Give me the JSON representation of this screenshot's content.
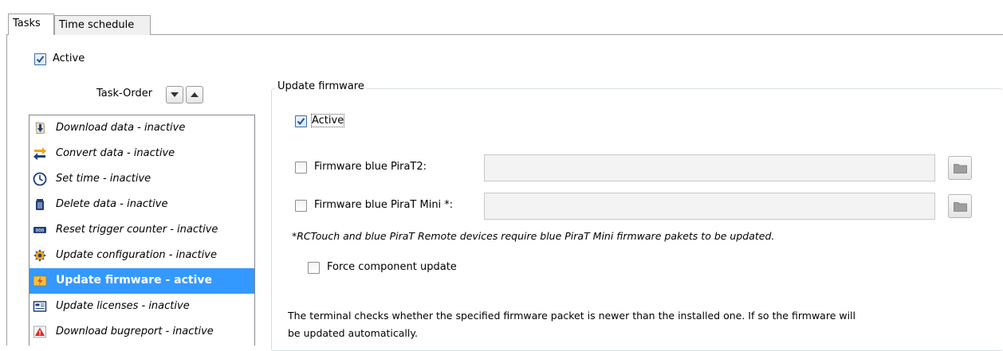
{
  "tabs": [
    {
      "label": "Tasks",
      "selected": true
    },
    {
      "label": "Time schedule",
      "selected": false
    }
  ],
  "active_checkbox": {
    "label": "Active",
    "checked": true
  },
  "task_order": {
    "label": "Task-Order"
  },
  "tasks": [
    {
      "label": "Download data - inactive",
      "icon": "download-arrow-icon",
      "selected": false
    },
    {
      "label": "Convert data - inactive",
      "icon": "convert-arrows-icon",
      "selected": false
    },
    {
      "label": "Set time - inactive",
      "icon": "clock-icon",
      "selected": false
    },
    {
      "label": "Delete data - inactive",
      "icon": "trash-icon",
      "selected": false
    },
    {
      "label": "Reset trigger counter - inactive",
      "icon": "counter-icon",
      "selected": false
    },
    {
      "label": "Update configuration - inactive",
      "icon": "gear-icon",
      "selected": false
    },
    {
      "label": "Update firmware - active",
      "icon": "firmware-icon",
      "selected": true
    },
    {
      "label": "Update licenses - inactive",
      "icon": "license-icon",
      "selected": false
    },
    {
      "label": "Download bugreport - inactive",
      "icon": "bugreport-icon",
      "selected": false
    }
  ],
  "update_firmware": {
    "title": "Update firmware",
    "active": {
      "label": "Active",
      "checked": true
    },
    "firmware_pirat2": {
      "label": "Firmware blue PiraT2:",
      "checked": false,
      "value": ""
    },
    "firmware_pirat_mini": {
      "label": "Firmware blue PiraT Mini *:",
      "checked": false,
      "value": ""
    },
    "footnote": "*RCTouch and blue PiraT Remote devices require blue PiraT Mini firmware pakets to be updated.",
    "force_update": {
      "label": "Force component update",
      "checked": false
    },
    "description_line1": "The terminal checks whether the specified firmware packet is newer than the installed one. If so the firmware will",
    "description_line2": "be updated automatically."
  },
  "colors": {
    "selection": "#3399ff",
    "checkbox_check": "#2b4f86"
  }
}
